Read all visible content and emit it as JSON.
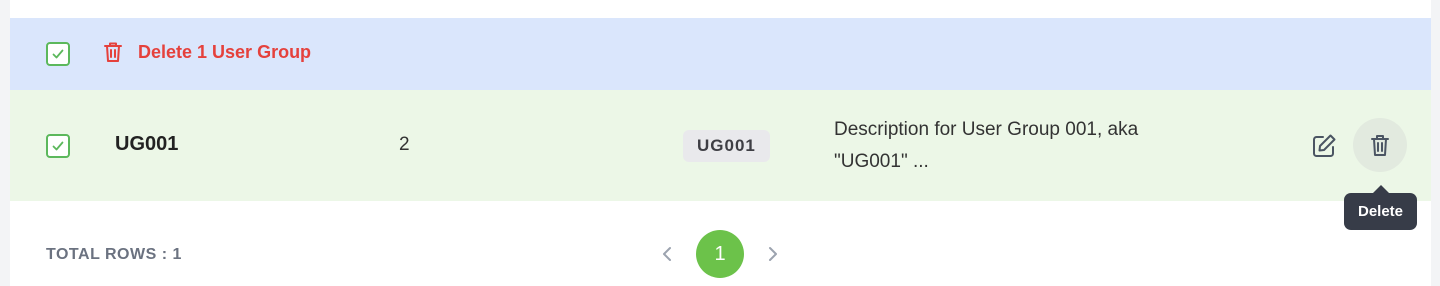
{
  "bulk_actions": {
    "delete_label": "Delete 1 User Group"
  },
  "table": {
    "rows": [
      {
        "code": "UG001",
        "count": "2",
        "badge": "UG001",
        "description": "Description for User Group 001, aka \"UG001\" ..."
      }
    ]
  },
  "tooltip": {
    "text": "Delete"
  },
  "footer": {
    "total_rows": "TOTAL ROWS : 1"
  },
  "pagination": {
    "current_page": "1"
  },
  "colors": {
    "bulk_bar_bg": "#dae6fc",
    "selected_row_bg": "#ecf7e7",
    "danger": "#e5413c",
    "checkbox_green": "#5cb85c",
    "page_active": "#6cc24a"
  },
  "icons": {
    "check": "check-icon",
    "trash": "trash-icon",
    "edit": "edit-icon",
    "prev": "chevron-left-icon",
    "next": "chevron-right-icon"
  }
}
